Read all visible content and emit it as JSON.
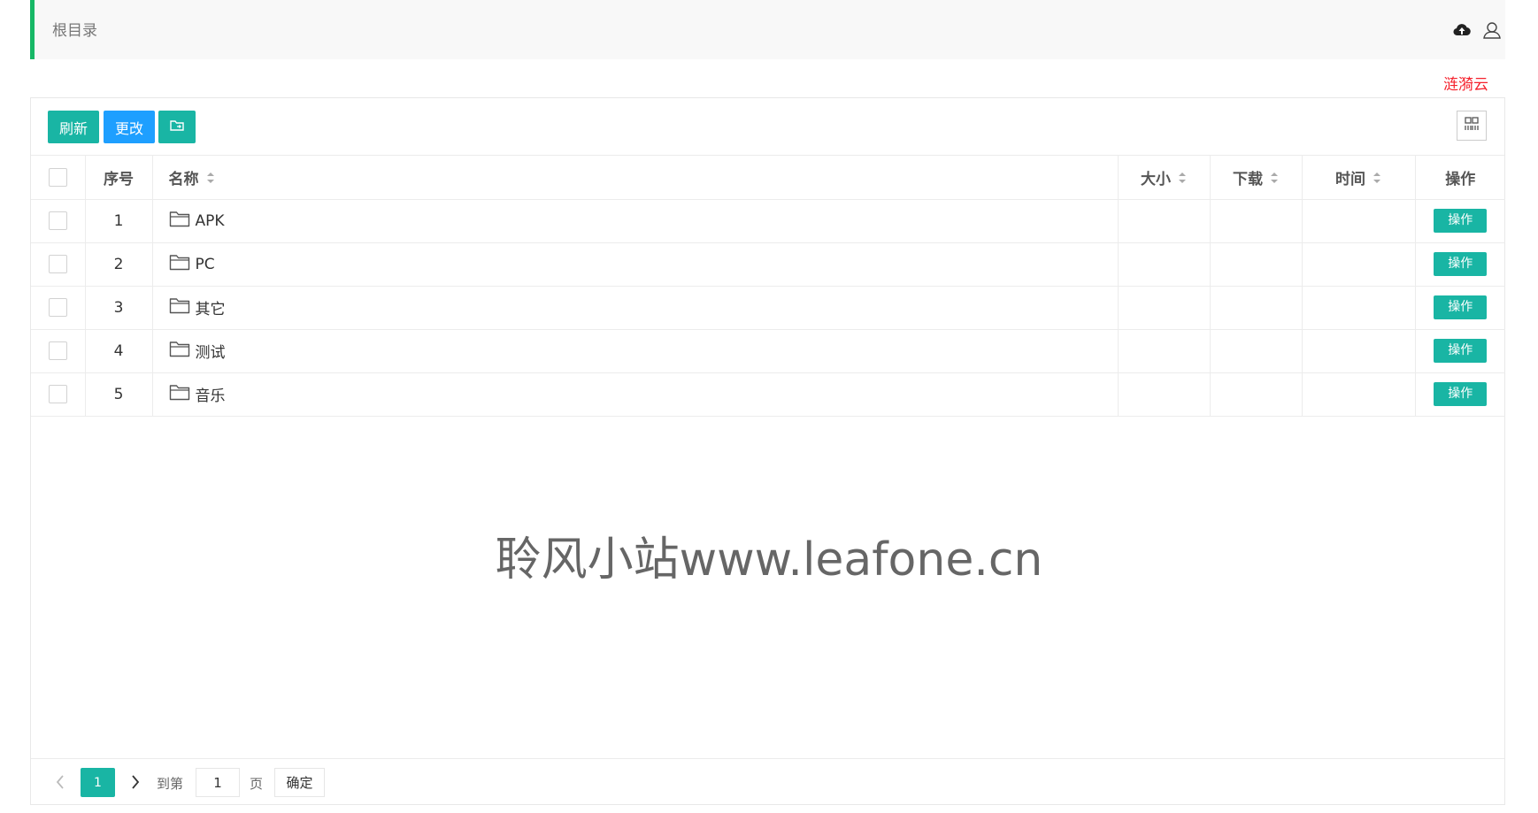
{
  "header": {
    "breadcrumb": "根目录",
    "upload_icon": "cloud-upload-icon",
    "user_icon": "user-icon"
  },
  "brand": {
    "label": "涟漪云",
    "color": "#f5222d"
  },
  "toolbar": {
    "refresh_label": "刷新",
    "change_label": "更改",
    "folder_icon": "folder-sync-icon",
    "view_icon": "grid-view-icon"
  },
  "table": {
    "headers": {
      "index": "序号",
      "name": "名称",
      "size": "大小",
      "download": "下载",
      "time": "时间",
      "action": "操作"
    },
    "rows": [
      {
        "index": "1",
        "name": "APK",
        "size": "",
        "download": "",
        "time": "",
        "action": "操作"
      },
      {
        "index": "2",
        "name": "PC",
        "size": "",
        "download": "",
        "time": "",
        "action": "操作"
      },
      {
        "index": "3",
        "name": "其它",
        "size": "",
        "download": "",
        "time": "",
        "action": "操作"
      },
      {
        "index": "4",
        "name": "测试",
        "size": "",
        "download": "",
        "time": "",
        "action": "操作"
      },
      {
        "index": "5",
        "name": "音乐",
        "size": "",
        "download": "",
        "time": "",
        "action": "操作"
      }
    ]
  },
  "watermark": "聆风小站www.leafone.cn",
  "pagination": {
    "current_page": "1",
    "goto_label": "到第",
    "input_value": "1",
    "page_label": "页",
    "confirm_label": "确定"
  },
  "colors": {
    "accent_green": "#17b866",
    "teal": "#19b5a4",
    "blue": "#1e9fff"
  }
}
